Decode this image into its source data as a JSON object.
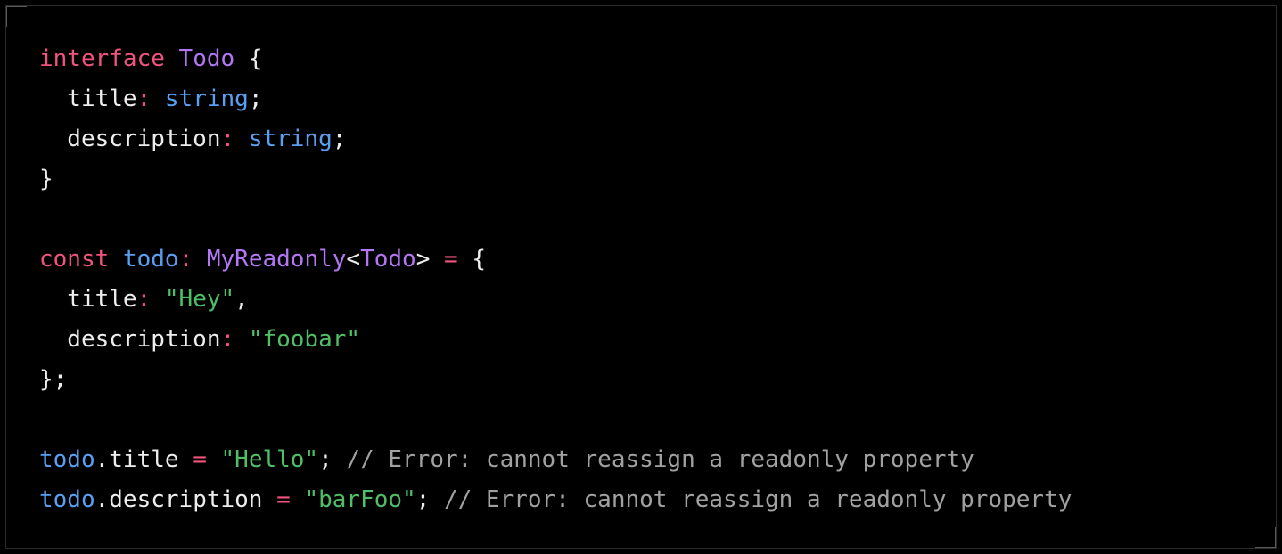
{
  "code_block": {
    "lines": [
      [
        {
          "t": "interface",
          "c": "kw"
        },
        {
          "t": " ",
          "c": "punct"
        },
        {
          "t": "Todo",
          "c": "type"
        },
        {
          "t": " {",
          "c": "punct"
        }
      ],
      [
        {
          "t": "  title",
          "c": "prop"
        },
        {
          "t": ":",
          "c": "op"
        },
        {
          "t": " ",
          "c": "punct"
        },
        {
          "t": "string",
          "c": "builtin"
        },
        {
          "t": ";",
          "c": "punct"
        }
      ],
      [
        {
          "t": "  description",
          "c": "prop"
        },
        {
          "t": ":",
          "c": "op"
        },
        {
          "t": " ",
          "c": "punct"
        },
        {
          "t": "string",
          "c": "builtin"
        },
        {
          "t": ";",
          "c": "punct"
        }
      ],
      [
        {
          "t": "}",
          "c": "punct"
        }
      ],
      [],
      [
        {
          "t": "const",
          "c": "kw"
        },
        {
          "t": " ",
          "c": "punct"
        },
        {
          "t": "todo",
          "c": "ident"
        },
        {
          "t": ":",
          "c": "op"
        },
        {
          "t": " ",
          "c": "punct"
        },
        {
          "t": "MyReadonly",
          "c": "type"
        },
        {
          "t": "<",
          "c": "punct"
        },
        {
          "t": "Todo",
          "c": "type"
        },
        {
          "t": ">",
          "c": "punct"
        },
        {
          "t": " ",
          "c": "punct"
        },
        {
          "t": "=",
          "c": "op"
        },
        {
          "t": " {",
          "c": "punct"
        }
      ],
      [
        {
          "t": "  title",
          "c": "prop"
        },
        {
          "t": ":",
          "c": "op"
        },
        {
          "t": " ",
          "c": "punct"
        },
        {
          "t": "\"Hey\"",
          "c": "str"
        },
        {
          "t": ",",
          "c": "punct"
        }
      ],
      [
        {
          "t": "  description",
          "c": "prop"
        },
        {
          "t": ":",
          "c": "op"
        },
        {
          "t": " ",
          "c": "punct"
        },
        {
          "t": "\"foobar\"",
          "c": "str"
        }
      ],
      [
        {
          "t": "};",
          "c": "punct"
        }
      ],
      [],
      [
        {
          "t": "todo",
          "c": "ident"
        },
        {
          "t": ".title",
          "c": "prop"
        },
        {
          "t": " ",
          "c": "punct"
        },
        {
          "t": "=",
          "c": "op"
        },
        {
          "t": " ",
          "c": "punct"
        },
        {
          "t": "\"Hello\"",
          "c": "str"
        },
        {
          "t": "; ",
          "c": "punct"
        },
        {
          "t": "// Error: cannot reassign a readonly property",
          "c": "comment"
        }
      ],
      [
        {
          "t": "todo",
          "c": "ident"
        },
        {
          "t": ".description",
          "c": "prop"
        },
        {
          "t": " ",
          "c": "punct"
        },
        {
          "t": "=",
          "c": "op"
        },
        {
          "t": " ",
          "c": "punct"
        },
        {
          "t": "\"barFoo\"",
          "c": "str"
        },
        {
          "t": "; ",
          "c": "punct"
        },
        {
          "t": "// Error: cannot reassign a readonly property",
          "c": "comment"
        }
      ]
    ]
  },
  "colors": {
    "background": "#000000",
    "keyword": "#f0547c",
    "type": "#b377f5",
    "builtin": "#5aa0f2",
    "string": "#4fbf67",
    "text": "#ededed",
    "comment": "#a1a1a1"
  }
}
